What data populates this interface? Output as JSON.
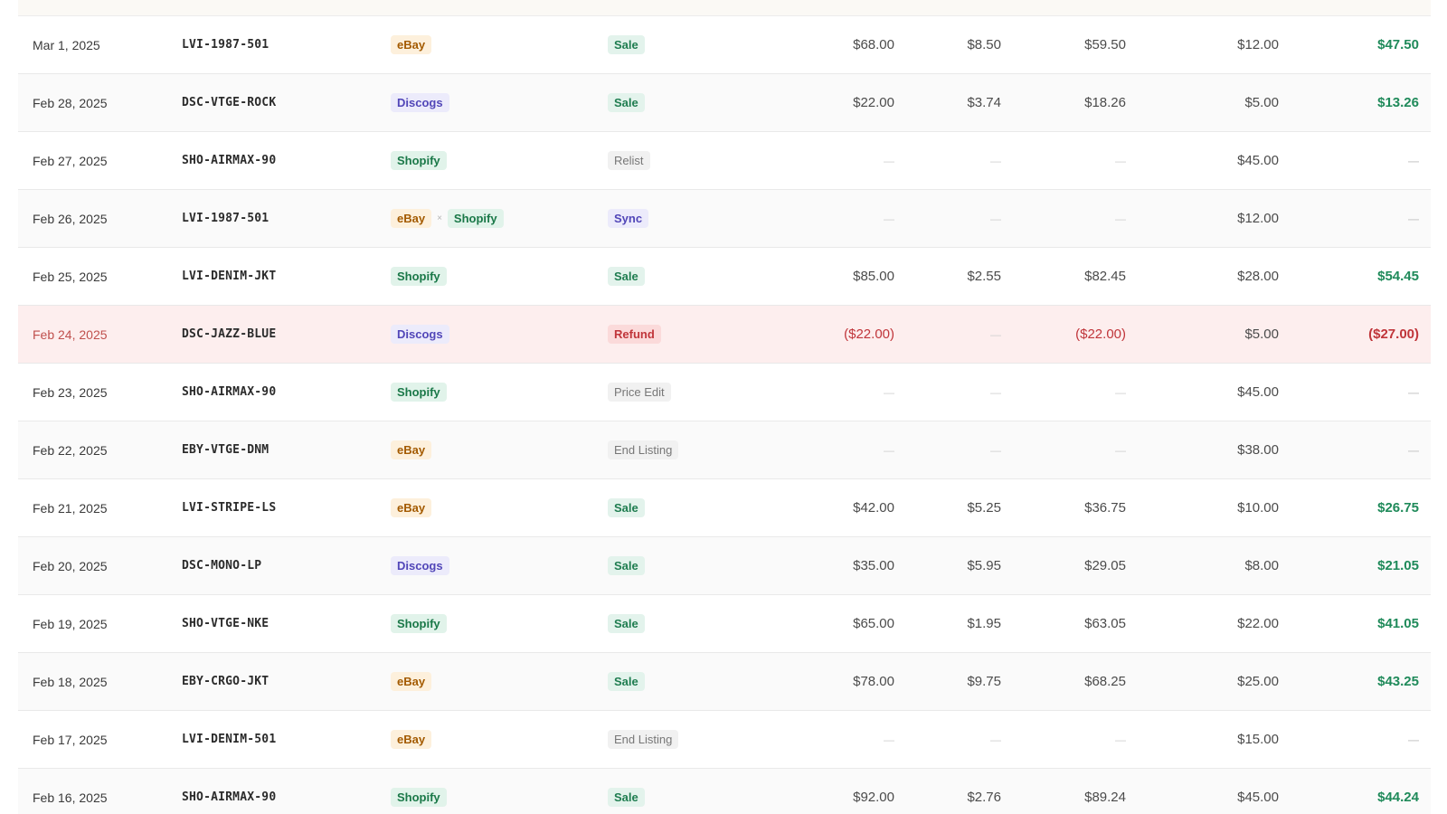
{
  "ledger": {
    "rows": [
      {
        "date": "Mar 1, 2025",
        "sku": "LVI-1987-501",
        "channels": [
          "eBay"
        ],
        "type": "Sale",
        "gross": "$68.00",
        "fee": "$8.50",
        "net": "$59.50",
        "cogs": "$12.00",
        "profit": "$47.50"
      },
      {
        "date": "Feb 28, 2025",
        "sku": "DSC-VTGE-ROCK",
        "channels": [
          "Discogs"
        ],
        "type": "Sale",
        "gross": "$22.00",
        "fee": "$3.74",
        "net": "$18.26",
        "cogs": "$5.00",
        "profit": "$13.26"
      },
      {
        "date": "Feb 27, 2025",
        "sku": "SHO-AIRMAX-90",
        "channels": [
          "Shopify"
        ],
        "type": "Relist",
        "gross": "—",
        "fee": "—",
        "net": "—",
        "cogs": "$45.00",
        "profit": "—"
      },
      {
        "date": "Feb 26, 2025",
        "sku": "LVI-1987-501",
        "channels": [
          "eBay",
          "Shopify"
        ],
        "channel_separator": "×",
        "type": "Sync",
        "gross": "—",
        "fee": "—",
        "net": "—",
        "cogs": "$12.00",
        "profit": "—"
      },
      {
        "date": "Feb 25, 2025",
        "sku": "LVI-DENIM-JKT",
        "channels": [
          "Shopify"
        ],
        "type": "Sale",
        "gross": "$85.00",
        "fee": "$2.55",
        "net": "$82.45",
        "cogs": "$28.00",
        "profit": "$54.45"
      },
      {
        "date": "Feb 24, 2025",
        "sku": "DSC-JAZZ-BLUE",
        "channels": [
          "Discogs"
        ],
        "type": "Refund",
        "gross": "($22.00)",
        "fee": "—",
        "net": "($22.00)",
        "cogs": "$5.00",
        "profit": "($27.00)"
      },
      {
        "date": "Feb 23, 2025",
        "sku": "SHO-AIRMAX-90",
        "channels": [
          "Shopify"
        ],
        "type": "Price Edit",
        "gross": "—",
        "fee": "—",
        "net": "—",
        "cogs": "$45.00",
        "profit": "—"
      },
      {
        "date": "Feb 22, 2025",
        "sku": "EBY-VTGE-DNM",
        "channels": [
          "eBay"
        ],
        "type": "End Listing",
        "gross": "—",
        "fee": "—",
        "net": "—",
        "cogs": "$38.00",
        "profit": "—"
      },
      {
        "date": "Feb 21, 2025",
        "sku": "LVI-STRIPE-LS",
        "channels": [
          "eBay"
        ],
        "type": "Sale",
        "gross": "$42.00",
        "fee": "$5.25",
        "net": "$36.75",
        "cogs": "$10.00",
        "profit": "$26.75"
      },
      {
        "date": "Feb 20, 2025",
        "sku": "DSC-MONO-LP",
        "channels": [
          "Discogs"
        ],
        "type": "Sale",
        "gross": "$35.00",
        "fee": "$5.95",
        "net": "$29.05",
        "cogs": "$8.00",
        "profit": "$21.05"
      },
      {
        "date": "Feb 19, 2025",
        "sku": "SHO-VTGE-NKE",
        "channels": [
          "Shopify"
        ],
        "type": "Sale",
        "gross": "$65.00",
        "fee": "$1.95",
        "net": "$63.05",
        "cogs": "$22.00",
        "profit": "$41.05"
      },
      {
        "date": "Feb 18, 2025",
        "sku": "EBY-CRGO-JKT",
        "channels": [
          "eBay"
        ],
        "type": "Sale",
        "gross": "$78.00",
        "fee": "$9.75",
        "net": "$68.25",
        "cogs": "$25.00",
        "profit": "$43.25"
      },
      {
        "date": "Feb 17, 2025",
        "sku": "LVI-DENIM-501",
        "channels": [
          "eBay"
        ],
        "type": "End Listing",
        "gross": "—",
        "fee": "—",
        "net": "—",
        "cogs": "$15.00",
        "profit": "—"
      },
      {
        "date": "Feb 16, 2025",
        "sku": "SHO-AIRMAX-90",
        "channels": [
          "Shopify"
        ],
        "type": "Sale",
        "gross": "$92.00",
        "fee": "$2.76",
        "net": "$89.24",
        "cogs": "$45.00",
        "profit": "$44.24"
      }
    ]
  }
}
